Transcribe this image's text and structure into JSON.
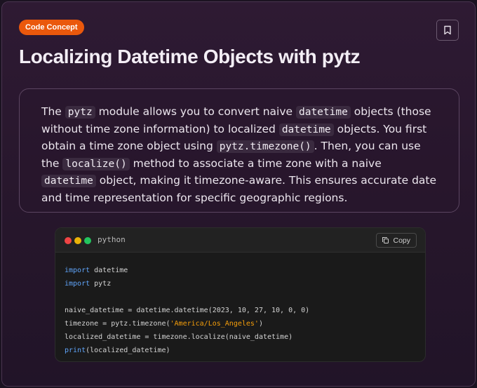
{
  "header": {
    "badge": "Code Concept",
    "title": "Localizing Datetime Objects with pytz",
    "bookmark_icon": "bookmark-icon"
  },
  "description": {
    "parts": [
      "The ",
      "pytz",
      " module allows you to convert naive ",
      "datetime",
      " objects (those without time zone information) to localized ",
      "datetime",
      " objects. You first obtain a time zone object using ",
      "pytz.timezone()",
      ". Then, you can use the ",
      "localize()",
      " method to associate a time zone with a naive ",
      "datetime",
      " object, making it timezone-aware. This ensures accurate date and time representation for specific geographic regions."
    ]
  },
  "code_block": {
    "language": "python",
    "copy_label": "Copy",
    "copy_icon": "copy-icon",
    "lines": {
      "l1_kw": "import",
      "l1_rest": " datetime",
      "l2_kw": "import",
      "l2_rest": " pytz",
      "l4": "naive_datetime = datetime.datetime(2023, 10, 27, 10, 0, 0)",
      "l5_pre": "timezone = pytz.timezone(",
      "l5_str": "'America/Los_Angeles'",
      "l5_post": ")",
      "l6": "localized_datetime = timezone.localize(naive_datetime)",
      "l7_fn": "print",
      "l7_rest": "(localized_datetime)"
    }
  },
  "colors": {
    "badge_bg": "#ea580c",
    "keyword": "#60a5fa",
    "string": "#f59e0b",
    "dot_red": "#ef4444",
    "dot_yellow": "#eab308",
    "dot_green": "#22c55e"
  }
}
